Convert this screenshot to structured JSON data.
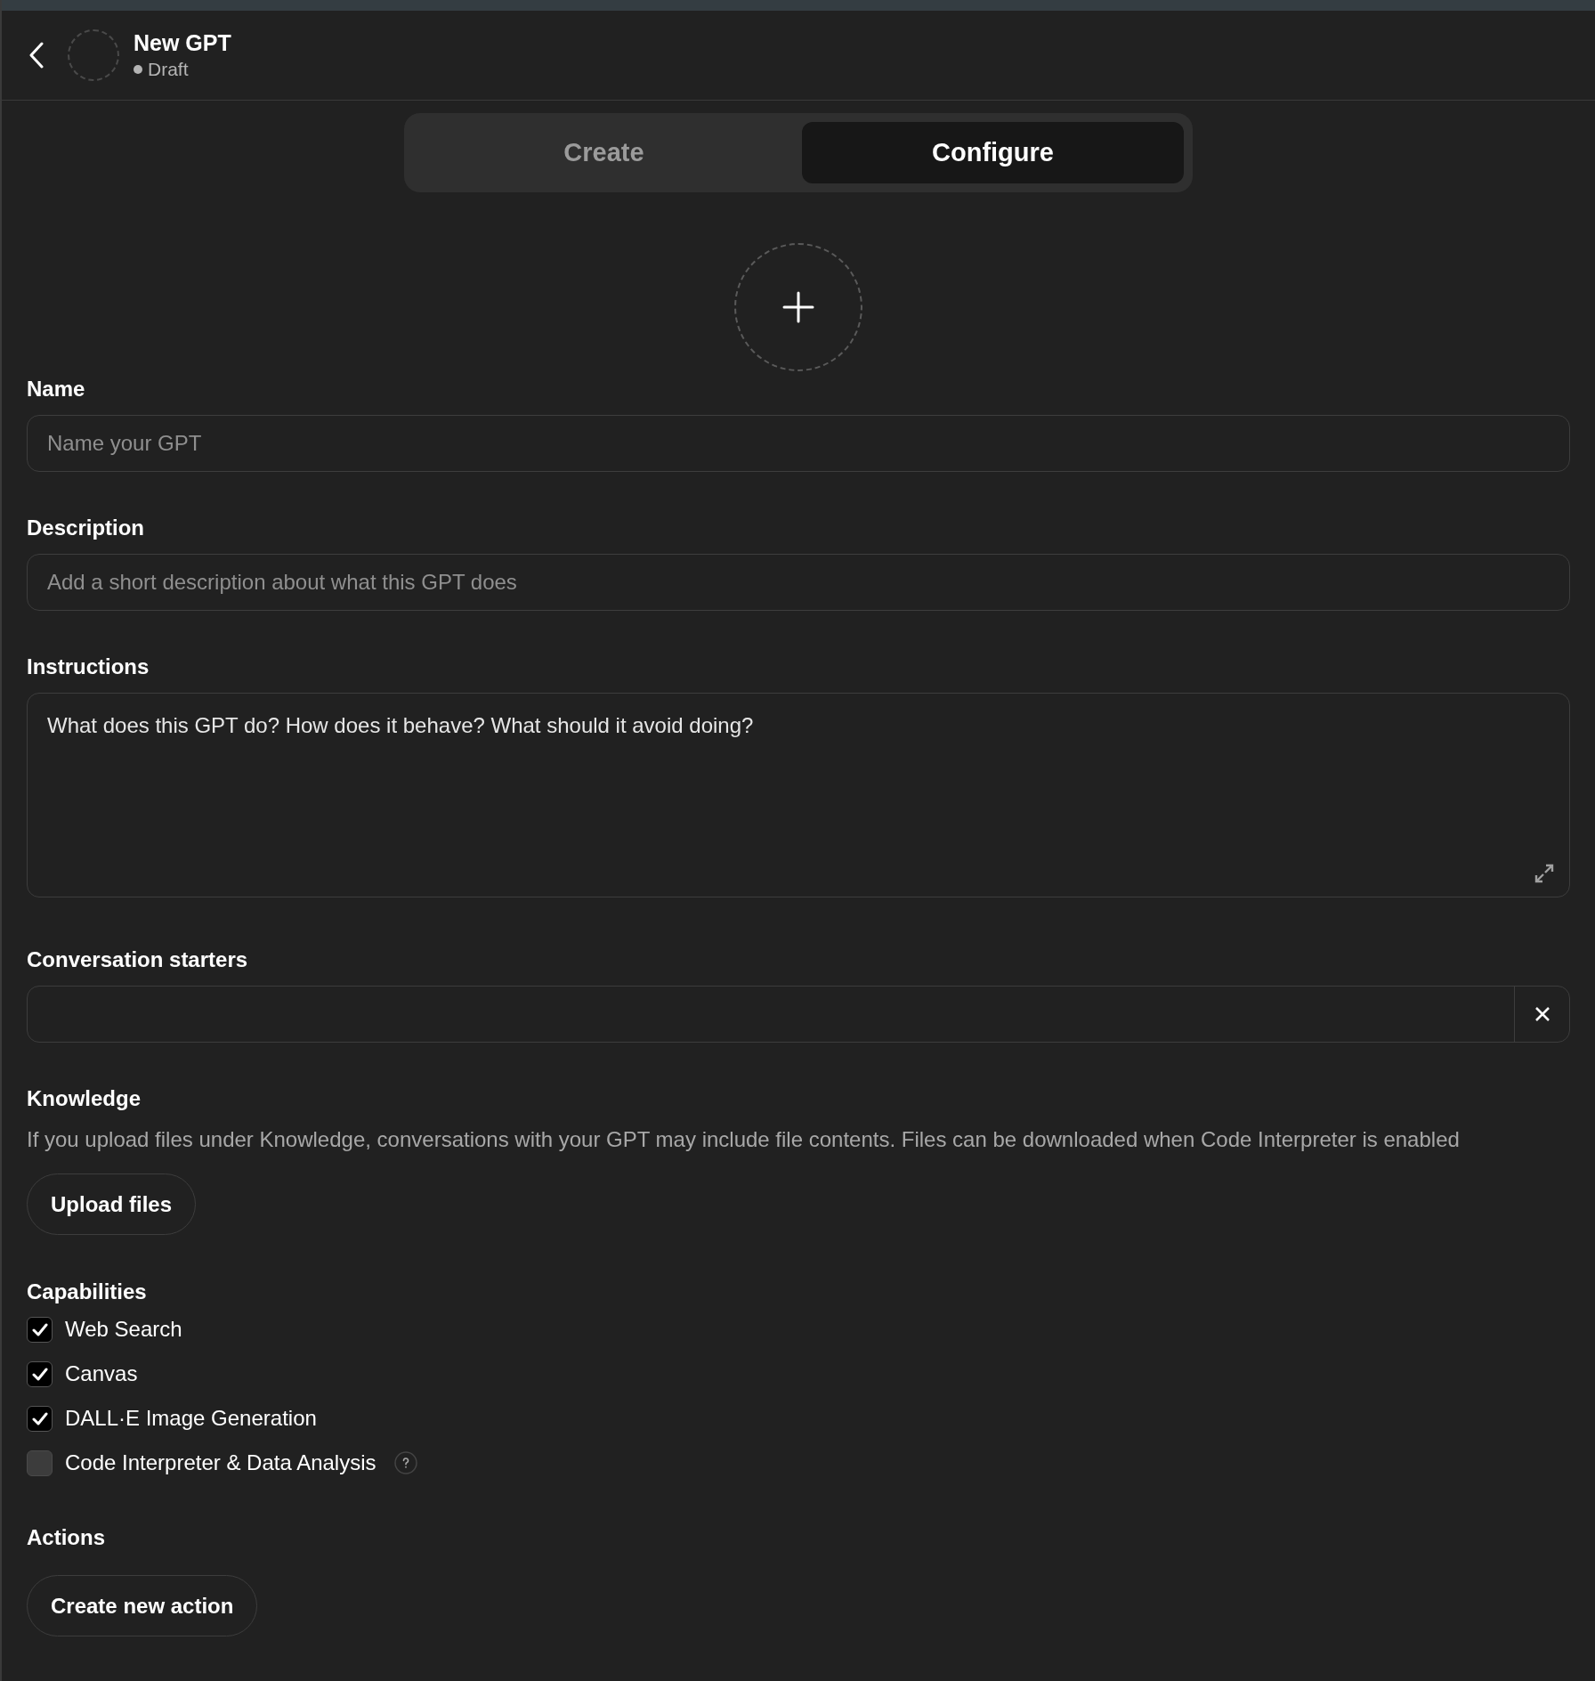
{
  "header": {
    "title": "New GPT",
    "status": "Draft"
  },
  "tabs": [
    {
      "label": "Create",
      "selected": false
    },
    {
      "label": "Configure",
      "selected": true
    }
  ],
  "name": {
    "label": "Name",
    "placeholder": "Name your GPT"
  },
  "description": {
    "label": "Description",
    "placeholder": "Add a short description about what this GPT does"
  },
  "instructions": {
    "label": "Instructions",
    "placeholder": "What does this GPT do? How does it behave? What should it avoid doing?"
  },
  "conversation_starters": {
    "label": "Conversation starters"
  },
  "knowledge": {
    "label": "Knowledge",
    "text": "If you upload files under Knowledge, conversations with your GPT may include file contents. Files can be downloaded when Code Interpreter is enabled",
    "button": "Upload files"
  },
  "capabilities": {
    "label": "Capabilities",
    "items": [
      {
        "label": "Web Search",
        "checked": true,
        "help": false
      },
      {
        "label": "Canvas",
        "checked": true,
        "help": false
      },
      {
        "label": "DALL·E Image Generation",
        "checked": true,
        "help": false
      },
      {
        "label": "Code Interpreter & Data Analysis",
        "checked": false,
        "help": true
      }
    ]
  },
  "actions": {
    "label": "Actions",
    "button": "Create new action"
  }
}
